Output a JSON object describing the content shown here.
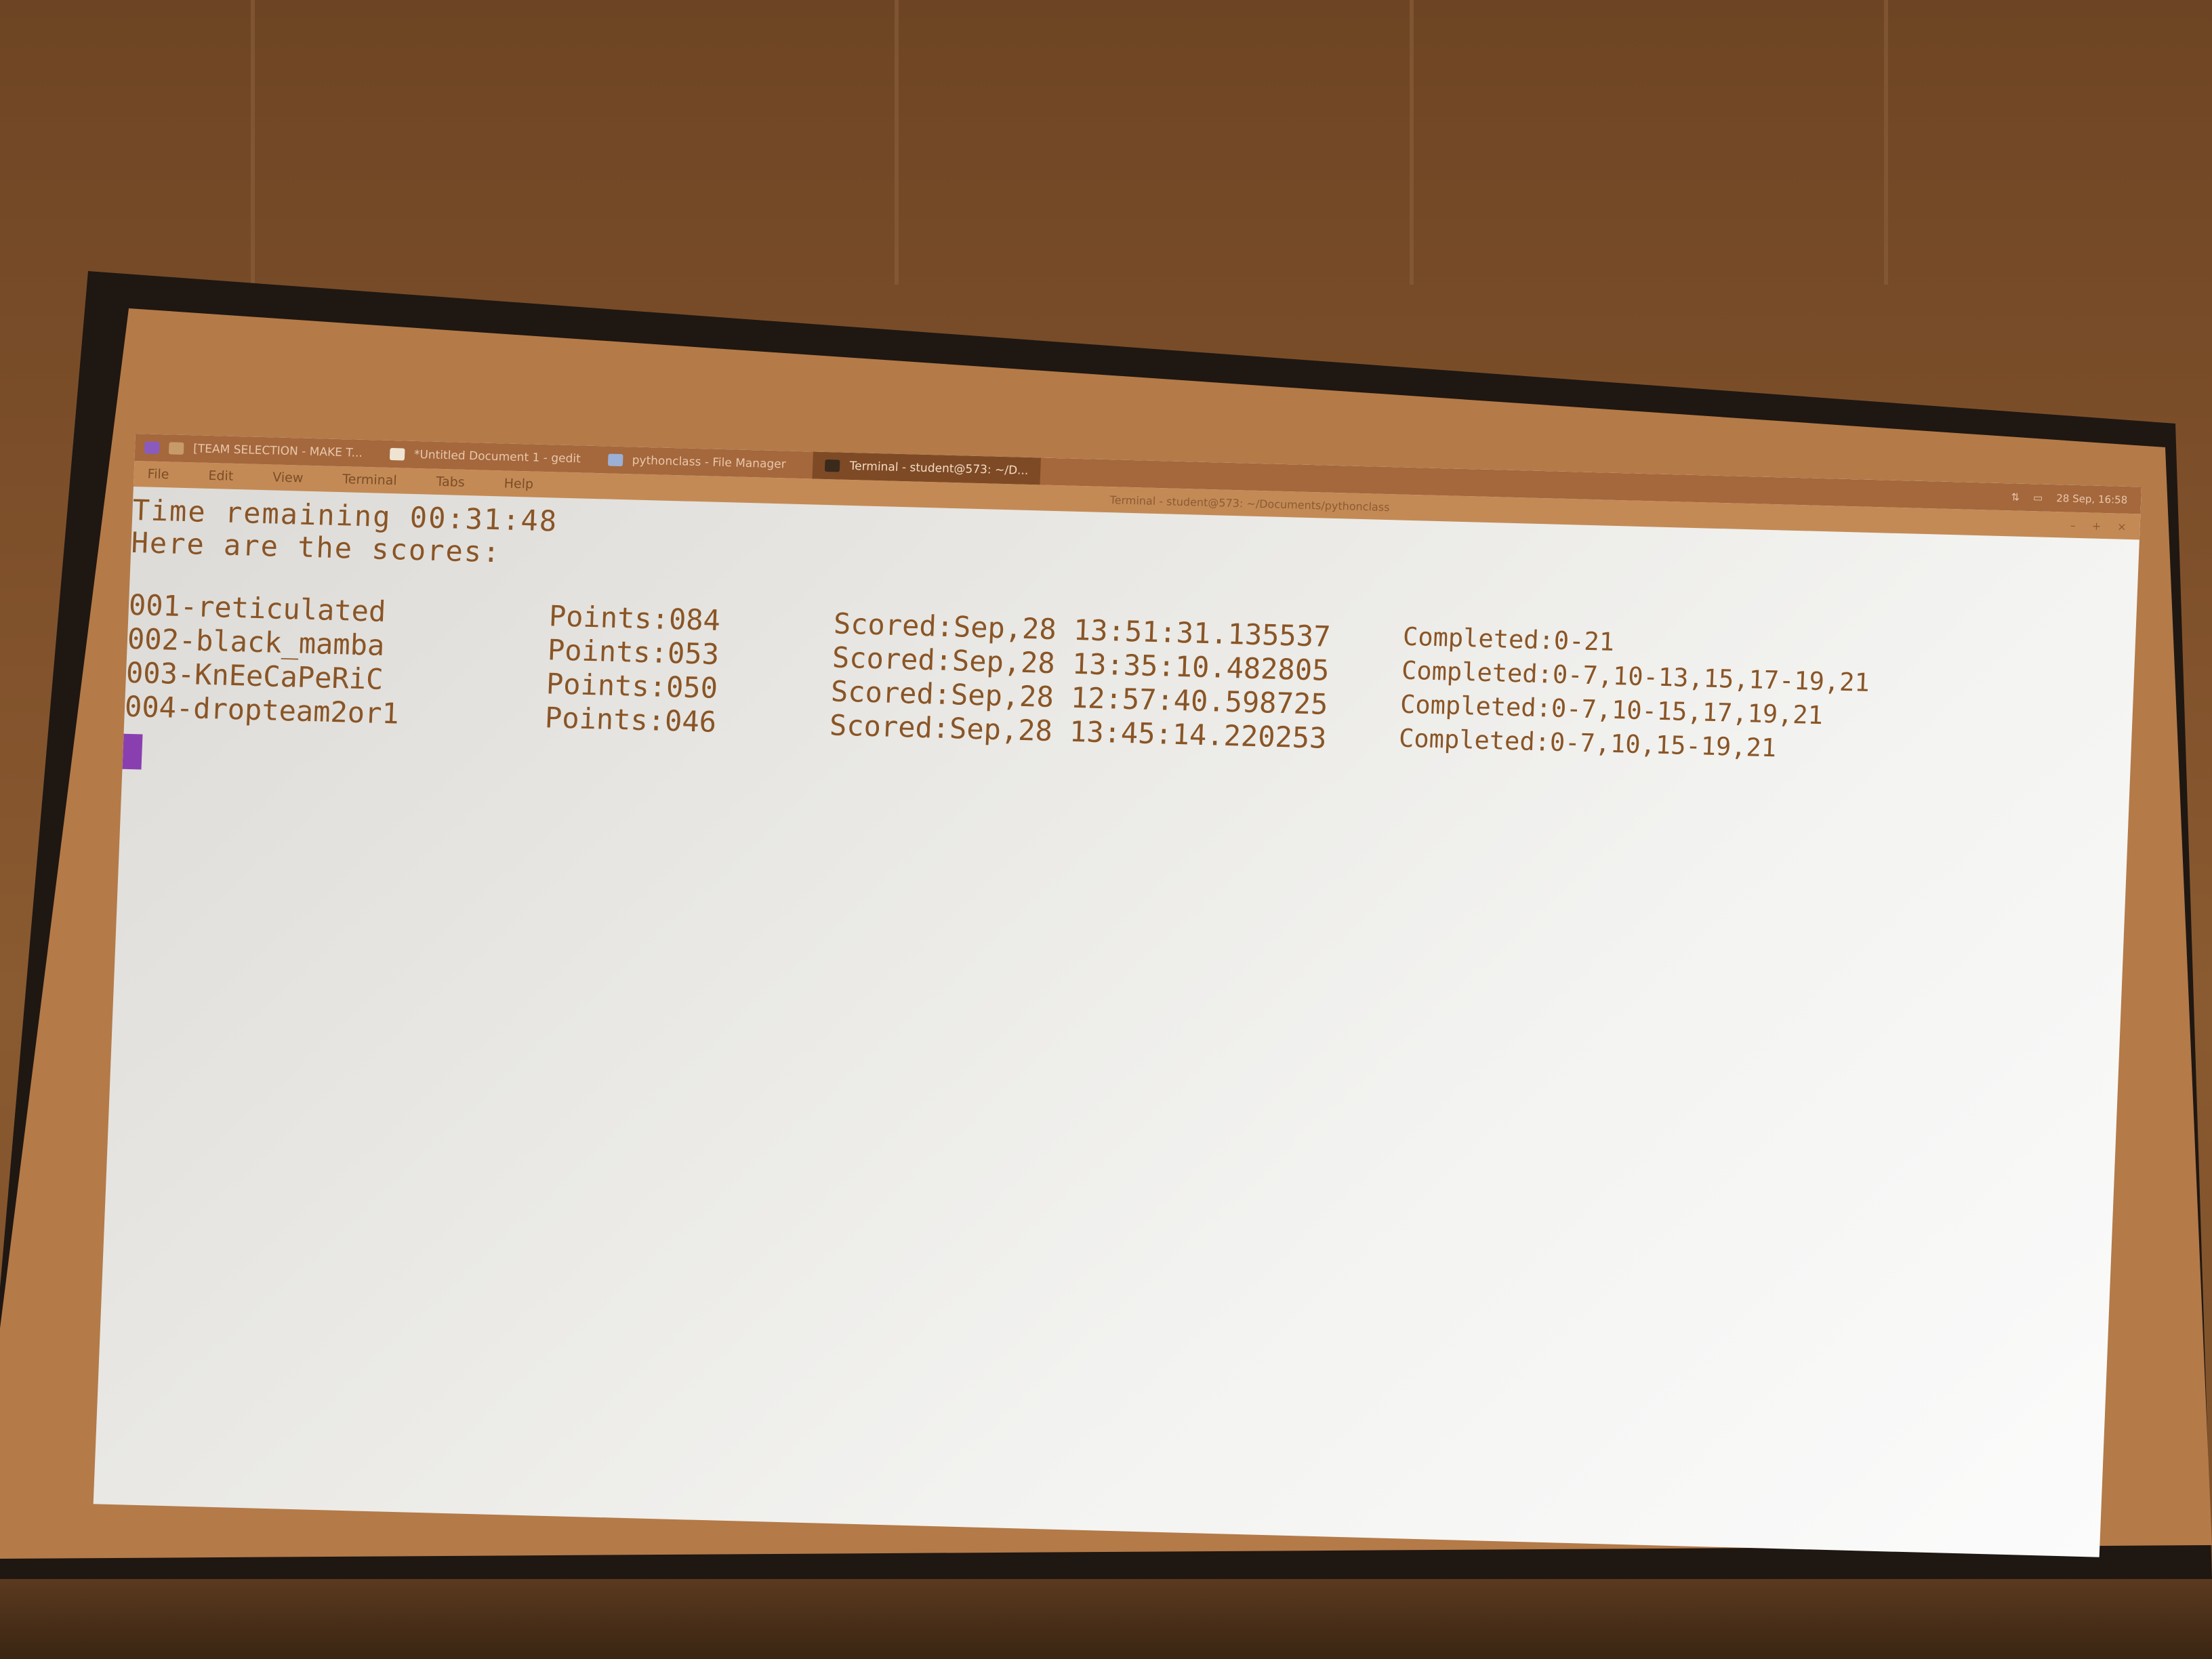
{
  "taskbar": {
    "tasks": [
      {
        "label": "[TEAM SELECTION - MAKE T...",
        "icon": "browser-icon"
      },
      {
        "label": "*Untitled Document 1 - gedit",
        "icon": "text-editor-icon"
      },
      {
        "label": "pythonclass - File Manager",
        "icon": "folder-icon"
      },
      {
        "label": "Terminal - student@573: ~/D...",
        "icon": "terminal-icon"
      }
    ],
    "clock": "28 Sep, 16:58"
  },
  "menubar": {
    "items": [
      "File",
      "Edit",
      "View",
      "Terminal",
      "Tabs",
      "Help"
    ],
    "window_title": "Terminal - student@573: ~/Documents/pythonclass"
  },
  "terminal": {
    "time_line": "Time remaining 00:31:48",
    "header_line": "Here are the scores:",
    "scores": [
      {
        "team": "001-reticulated",
        "points": "Points:084",
        "scored": "Scored:Sep,28 13:51:31.135537",
        "completed": "Completed:0-21"
      },
      {
        "team": "002-black_mamba",
        "points": "Points:053",
        "scored": "Scored:Sep,28 13:35:10.482805",
        "completed": "Completed:0-7,10-13,15,17-19,21"
      },
      {
        "team": "003-KnEeCaPeRiC",
        "points": "Points:050",
        "scored": "Scored:Sep,28 12:57:40.598725",
        "completed": "Completed:0-7,10-15,17,19,21"
      },
      {
        "team": "004-dropteam2or1",
        "points": "Points:046",
        "scored": "Scored:Sep,28 13:45:14.220253",
        "completed": "Completed:0-7,10,15-19,21"
      }
    ]
  },
  "colors": {
    "terminal_text": "#8a5526",
    "cursor": "#8a3fb0",
    "taskbar": "#a5673c",
    "menubar": "#c48a55"
  }
}
